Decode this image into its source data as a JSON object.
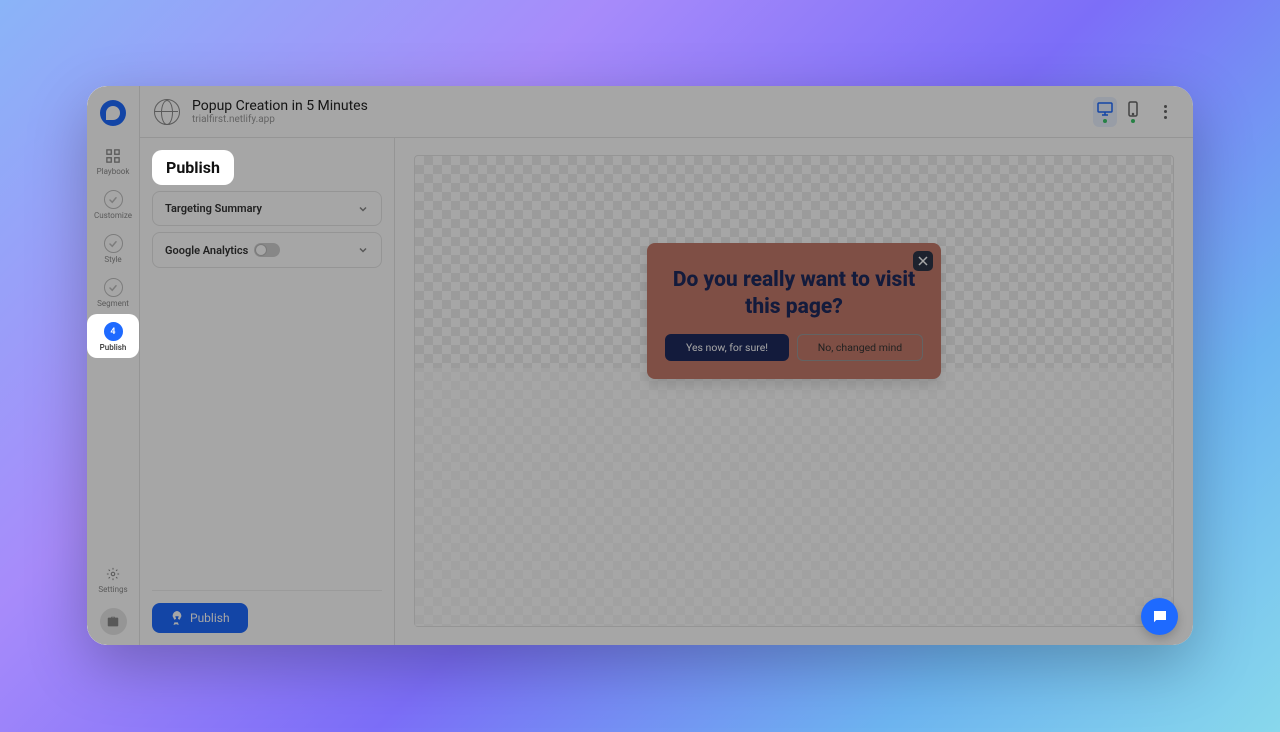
{
  "header": {
    "title": "Popup Creation in 5 Minutes",
    "subtitle": "trialfirst.netlify.app"
  },
  "sidebar": {
    "items": [
      {
        "label": "Playbook"
      },
      {
        "label": "Customize"
      },
      {
        "label": "Style"
      },
      {
        "label": "Segment"
      },
      {
        "label": "Publish",
        "step": "4"
      }
    ],
    "settings_label": "Settings"
  },
  "panel": {
    "title": "Publish",
    "accordions": [
      {
        "label": "Targeting Summary"
      },
      {
        "label": "Google Analytics",
        "toggle": false
      }
    ],
    "publish_btn": "Publish"
  },
  "popup": {
    "title": "Do you really want to visit this page?",
    "primary": "Yes now, for sure!",
    "secondary": "No, changed mind"
  }
}
